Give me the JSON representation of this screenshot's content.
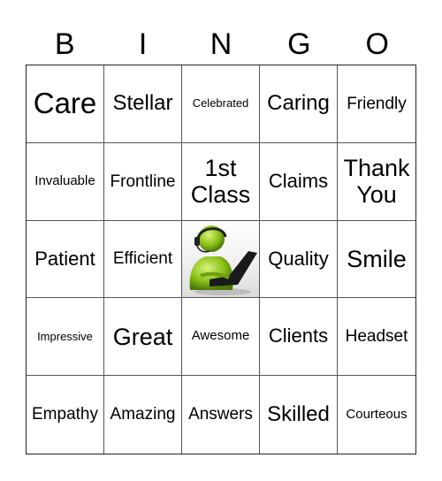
{
  "header": {
    "letters": [
      "B",
      "I",
      "N",
      "G",
      "O"
    ]
  },
  "grid": {
    "rows": [
      [
        "Care",
        "Stellar",
        "Celebrated",
        "Caring",
        "Friendly"
      ],
      [
        "Invaluable",
        "Frontline",
        "1st Class",
        "Claims",
        "Thank You"
      ],
      [
        "Patient",
        "Efficient",
        "",
        "Quality",
        "Smile"
      ],
      [
        "Impressive",
        "Great",
        "Awesome",
        "Clients",
        "Headset"
      ],
      [
        "Empathy",
        "Amazing",
        "Answers",
        "Skilled",
        "Courteous"
      ]
    ],
    "free_space": {
      "icon": "customer-service-agent-icon",
      "colors": {
        "figure": "#8cc21a",
        "headset": "#222222",
        "laptop": "#1a1a1a"
      }
    }
  }
}
